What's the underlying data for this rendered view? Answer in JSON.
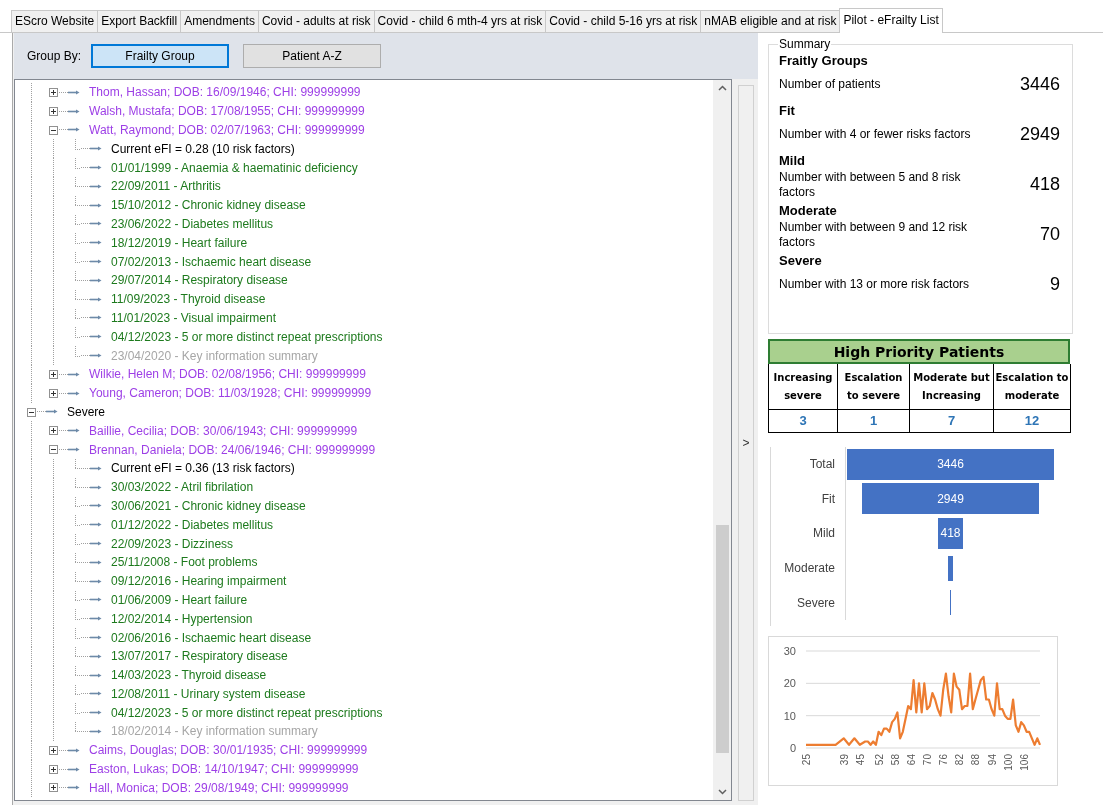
{
  "tabs": [
    {
      "label": "EScro Website",
      "selected": false
    },
    {
      "label": "Export Backfill",
      "selected": false
    },
    {
      "label": "Amendments",
      "selected": false
    },
    {
      "label": "Covid - adults at risk",
      "selected": false
    },
    {
      "label": "Covid - child 6 mth-4 yrs at risk",
      "selected": false
    },
    {
      "label": "Covid - child 5-16 yrs at risk",
      "selected": false
    },
    {
      "label": "nMAB eligible and at risk",
      "selected": false
    },
    {
      "label": "Pilot - eFrailty List",
      "selected": true
    }
  ],
  "group_by": {
    "label": "Group By:",
    "options": [
      {
        "label": "Frailty Group",
        "selected": true
      },
      {
        "label": "Patient A-Z",
        "selected": false
      }
    ]
  },
  "tree": [
    {
      "kind": "continued",
      "children": [
        {
          "kind": "patient",
          "label": "Thom, Hassan; DOB: 16/09/1946; CHI: 999999999",
          "expanded": false
        },
        {
          "kind": "patient",
          "label": "Walsh, Mustafa; DOB: 17/08/1955; CHI: 999999999",
          "expanded": false
        },
        {
          "kind": "patient",
          "label": "Watt, Raymond; DOB: 02/07/1963; CHI: 999999999",
          "expanded": true,
          "children": [
            {
              "kind": "efi",
              "label": "Current eFI = 0.28 (10 risk factors)"
            },
            {
              "kind": "condition",
              "label": "01/01/1999 - Anaemia & haematinic deficiency"
            },
            {
              "kind": "condition",
              "label": "22/09/2011 - Arthritis"
            },
            {
              "kind": "condition",
              "label": "15/10/2012 - Chronic kidney disease"
            },
            {
              "kind": "condition",
              "label": "23/06/2022 - Diabetes mellitus"
            },
            {
              "kind": "condition",
              "label": "18/12/2019 - Heart failure"
            },
            {
              "kind": "condition",
              "label": "07/02/2013 - Ischaemic heart disease"
            },
            {
              "kind": "condition",
              "label": "29/07/2014 - Respiratory disease"
            },
            {
              "kind": "condition",
              "label": "11/09/2023 - Thyroid disease"
            },
            {
              "kind": "condition",
              "label": "11/01/2023 - Visual impairment"
            },
            {
              "kind": "condition",
              "label": "04/12/2023 - 5 or more distinct repeat prescriptions"
            },
            {
              "kind": "summary",
              "label": "23/04/2020 - Key information summary"
            }
          ]
        },
        {
          "kind": "patient",
          "label": "Wilkie, Helen M; DOB: 02/08/1956; CHI: 999999999",
          "expanded": false
        },
        {
          "kind": "patient",
          "label": "Young, Cameron; DOB: 11/03/1928; CHI: 999999999",
          "expanded": false
        }
      ]
    },
    {
      "kind": "group",
      "label": "Severe",
      "expanded": true,
      "children": [
        {
          "kind": "patient",
          "label": "Baillie, Cecilia; DOB: 30/06/1943; CHI: 999999999",
          "expanded": false
        },
        {
          "kind": "patient",
          "label": "Brennan, Daniela; DOB: 24/06/1946; CHI: 999999999",
          "expanded": true,
          "children": [
            {
              "kind": "efi",
              "label": "Current eFI = 0.36 (13 risk factors)"
            },
            {
              "kind": "condition",
              "label": "30/03/2022 - Atril fibrilation"
            },
            {
              "kind": "condition",
              "label": "30/06/2021 - Chronic kidney disease"
            },
            {
              "kind": "condition",
              "label": "01/12/2022 - Diabetes mellitus"
            },
            {
              "kind": "condition",
              "label": "22/09/2023 - Dizziness"
            },
            {
              "kind": "condition",
              "label": "25/11/2008 - Foot problems"
            },
            {
              "kind": "condition",
              "label": "09/12/2016 - Hearing impairment"
            },
            {
              "kind": "condition",
              "label": "01/06/2009 - Heart failure"
            },
            {
              "kind": "condition",
              "label": "12/02/2014 - Hypertension"
            },
            {
              "kind": "condition",
              "label": "02/06/2016 - Ischaemic heart disease"
            },
            {
              "kind": "condition",
              "label": "13/07/2017 - Respiratory disease"
            },
            {
              "kind": "condition",
              "label": "14/03/2023 - Thyroid disease"
            },
            {
              "kind": "condition",
              "label": "12/08/2011 - Urinary system disease"
            },
            {
              "kind": "condition",
              "label": "04/12/2023 - 5 or more distinct repeat prescriptions"
            },
            {
              "kind": "summary",
              "label": "18/02/2014 - Key information summary"
            }
          ]
        },
        {
          "kind": "patient",
          "label": "Caims, Douglas; DOB: 30/01/1935; CHI: 999999999",
          "expanded": false
        },
        {
          "kind": "patient",
          "label": "Easton, Lukas; DOB: 14/10/1947; CHI: 999999999",
          "expanded": false
        },
        {
          "kind": "patient",
          "label": "Hall, Monica; DOB: 29/08/1949; CHI: 999999999",
          "expanded": false
        }
      ]
    }
  ],
  "collapse_toggle": ">",
  "summary": {
    "legend": "Summary",
    "sections": [
      {
        "heading": "Fraitly Groups",
        "description": "Number of patients",
        "count": "3446"
      },
      {
        "heading": "Fit",
        "description": "Number with 4 or fewer risks factors",
        "count": "2949"
      },
      {
        "heading": "Mild",
        "description": "Number with between 5 and 8 risk factors",
        "count": "418"
      },
      {
        "heading": "Moderate",
        "description": "Number with between 9 and 12 risk factors",
        "count": "70"
      },
      {
        "heading": "Severe",
        "description": "Number with 13 or more risk factors",
        "count": "9"
      }
    ]
  },
  "high_priority": {
    "title": "High Priority Patients",
    "columns": [
      {
        "label": "Increasing severe",
        "value": "3"
      },
      {
        "label": "Escalation to severe",
        "value": "1"
      },
      {
        "label": "Moderate but Increasing",
        "value": "7"
      },
      {
        "label": "Escalation to moderate",
        "value": "12"
      }
    ]
  },
  "funnel": {
    "rows": [
      {
        "label": "Total",
        "value": "3446"
      },
      {
        "label": "Fit",
        "value": "2949"
      },
      {
        "label": "Mild",
        "value": "418"
      },
      {
        "label": "Moderate"
      },
      {
        "label": "Severe"
      }
    ]
  },
  "age_chart": {
    "chart_data": {
      "type": "line",
      "xlim": [
        25,
        112
      ],
      "ylim": [
        0,
        30
      ],
      "yticks": [
        0,
        10,
        20,
        30
      ],
      "x": [
        25,
        33,
        36,
        39,
        41,
        43,
        45,
        47,
        48,
        49,
        50,
        51,
        52,
        53,
        54,
        55,
        56,
        57,
        58,
        59,
        60,
        61,
        62,
        63,
        64,
        65,
        66,
        67,
        68,
        69,
        70,
        71,
        72,
        73,
        74,
        75,
        76,
        77,
        78,
        79,
        80,
        81,
        82,
        83,
        84,
        85,
        86,
        87,
        88,
        89,
        90,
        91,
        92,
        93,
        94,
        95,
        96,
        97,
        98,
        99,
        100,
        101,
        102,
        103,
        104,
        105,
        106,
        107,
        108,
        109,
        110,
        111,
        112
      ],
      "xticks": [
        25,
        39,
        45,
        52,
        58,
        64,
        70,
        76,
        82,
        88,
        94,
        100,
        106
      ],
      "series": [
        {
          "color": "#ed7d31",
          "values": [
            1,
            1,
            1,
            3,
            1,
            3,
            1,
            2,
            2,
            1,
            2,
            1,
            5,
            4,
            6,
            6,
            5,
            8,
            9,
            11,
            3,
            5,
            9,
            13,
            12,
            21,
            11,
            20,
            11,
            20,
            12,
            13,
            17,
            15,
            12,
            10,
            18,
            23,
            16,
            11,
            23,
            19,
            18,
            12,
            13,
            13,
            23,
            12,
            15,
            18,
            21,
            22,
            15,
            15,
            12,
            10,
            20,
            12,
            12,
            10,
            9,
            9,
            15,
            7,
            5,
            8,
            7,
            5,
            5,
            3,
            1,
            3,
            1
          ]
        }
      ]
    }
  }
}
